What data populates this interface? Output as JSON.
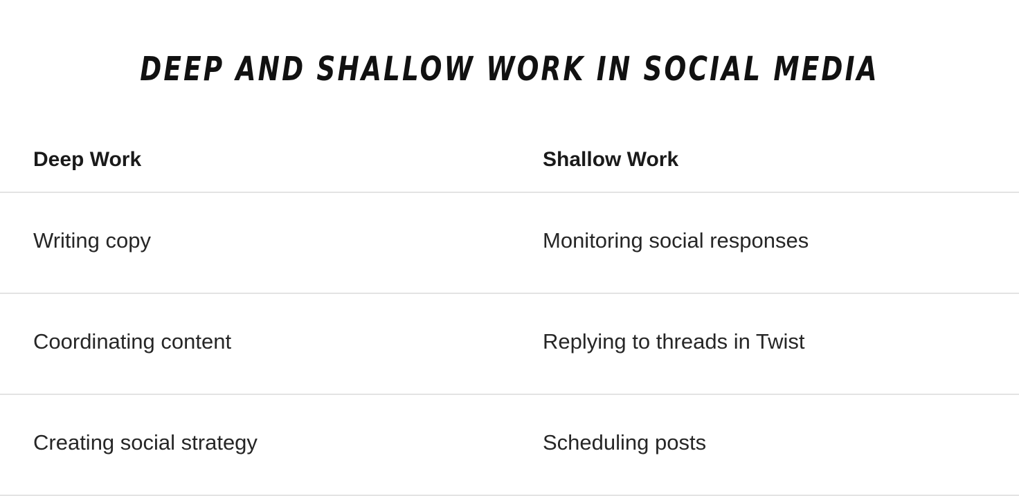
{
  "title": "DEEP AND SHALLOW WORK IN SOCIAL MEDIA",
  "table": {
    "headers": [
      "Deep Work",
      "Shallow Work"
    ],
    "rows": [
      [
        "Writing copy",
        "Monitoring social responses"
      ],
      [
        "Coordinating content",
        "Replying to threads in Twist"
      ],
      [
        "Creating social strategy",
        "Scheduling posts"
      ]
    ]
  }
}
